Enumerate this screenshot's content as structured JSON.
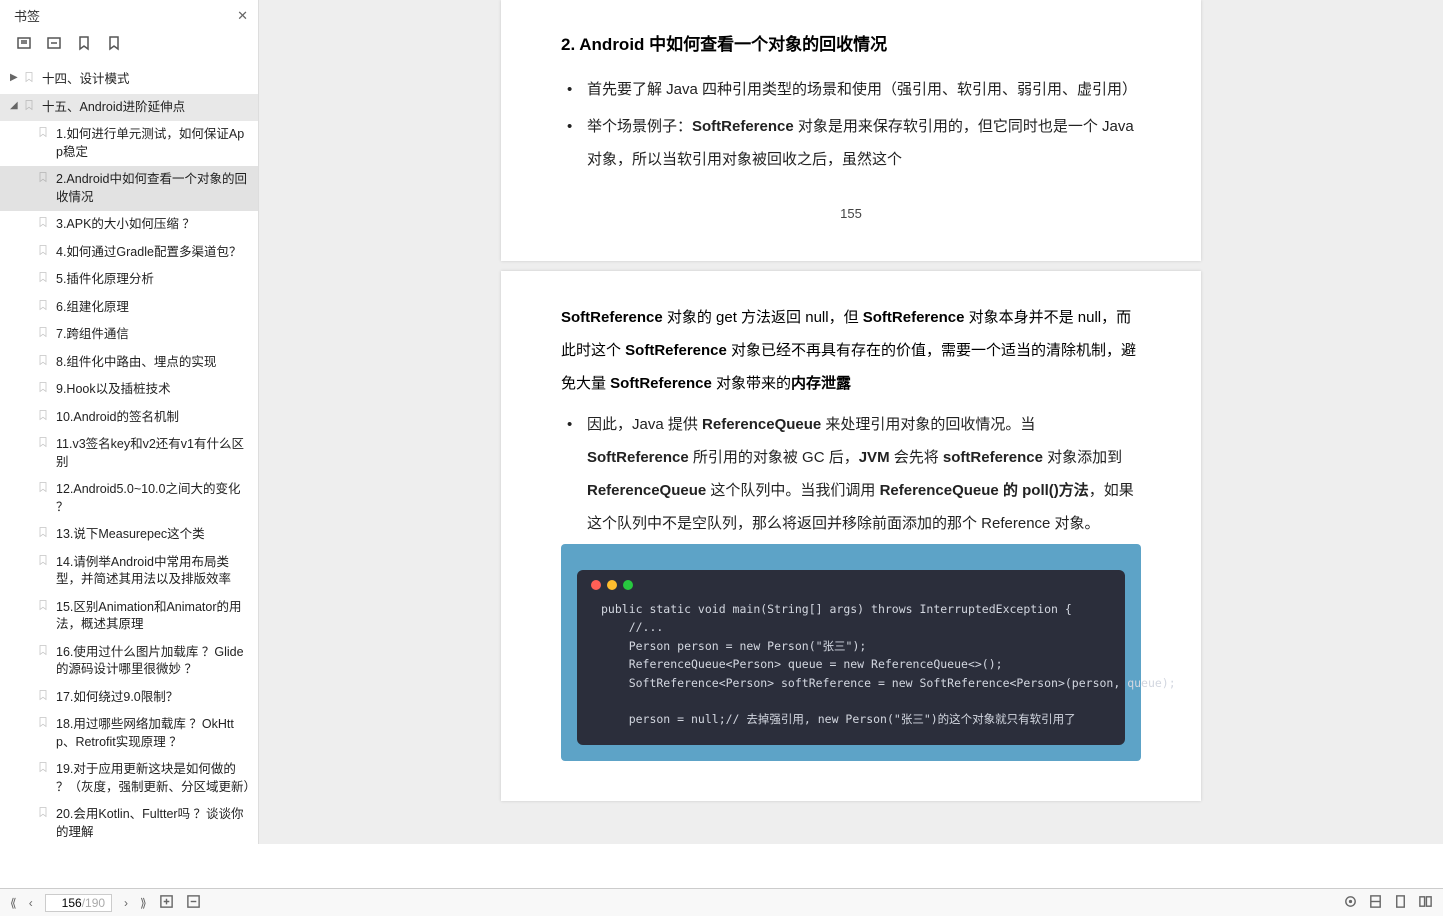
{
  "sidebar": {
    "title": "书签",
    "items": [
      {
        "label": "十四、设计模式",
        "level": 0,
        "caret": "▶"
      },
      {
        "label": "十五、Android进阶延伸点",
        "level": 0,
        "caret": "◢",
        "selected": false,
        "expanded": true
      },
      {
        "label": "1.如何进行单元测试，如何保证App稳定",
        "level": 1
      },
      {
        "label": "2.Android中如何查看一个对象的回收情况",
        "level": 1,
        "selected": true
      },
      {
        "label": "3.APK的大小如何压缩 ？",
        "level": 1
      },
      {
        "label": "4.如何通过Gradle配置多渠道包？",
        "level": 1
      },
      {
        "label": "5.插件化原理分析",
        "level": 1
      },
      {
        "label": "6.组建化原理",
        "level": 1
      },
      {
        "label": "7.跨组件通信",
        "level": 1
      },
      {
        "label": "8.组件化中路由、埋点的实现",
        "level": 1
      },
      {
        "label": "9.Hook以及插桩技术",
        "level": 1
      },
      {
        "label": "10.Android的签名机制",
        "level": 1
      },
      {
        "label": "11.v3签名key和v2还有v1有什么区别",
        "level": 1
      },
      {
        "label": "12.Android5.0~10.0之间大的变化 ？",
        "level": 1
      },
      {
        "label": "13.说下Measurepec这个类",
        "level": 1
      },
      {
        "label": "14.请例举Android中常用布局类型，并简述其用法以及排版效率",
        "level": 1
      },
      {
        "label": "15.区别Animation和Animator的用法，概述其原理",
        "level": 1
      },
      {
        "label": "16.使用过什么图片加载库 ？Glide的源码设计哪里很微妙 ？",
        "level": 1
      },
      {
        "label": "17.如何绕过9.0限制？",
        "level": 1
      },
      {
        "label": "18.用过哪些网络加载库 ？OkHttp、Retrofit实现原理 ？",
        "level": 1
      },
      {
        "label": "19.对于应用更新这块是如何做的 ？（灰度，强制更新、分区域更新）",
        "level": 1
      },
      {
        "label": "20.会用Kotlin、Fultter吗 ？谈谈你的理解",
        "level": 1
      }
    ]
  },
  "doc": {
    "page1": {
      "heading": "2.  Android 中如何查看一个对象的回收情况",
      "bullet1": "首先要了解 Java 四种引用类型的场景和使用（强引用、软引用、弱引用、虚引用）",
      "bullet2_pre": "举个场景例子：",
      "bullet2_b1": "SoftReference",
      "bullet2_mid": " 对象是用来保存软引用的，但它同时也是一个 Java 对象，所以当软引用对象被回收之后，虽然这个",
      "pagenum": "155"
    },
    "page2": {
      "para1_a": "SoftReference",
      "para1_b": " 对象的 get 方法返回 null，但 ",
      "para1_c": "SoftReference",
      "para1_d": " 对象本身并不是 null，而此时这个 ",
      "para1_e": "SoftReference",
      "para1_f": " 对象已经不再具有存在的价值，需要一个适当的清除机制，避免大量 ",
      "para1_g": "SoftReference",
      "para1_h": " 对象带来的",
      "para1_i": "内存泄露",
      "b2a": "因此，Java 提供 ",
      "b2b": "ReferenceQueue",
      "b2c": " 来处理引用对象的回收情况。当 ",
      "b2d": "SoftReference",
      "b2e": " 所引用的对象被 GC 后，",
      "b2f": "JVM",
      "b2g": " 会先将 ",
      "b2h": "softReference",
      "b2i": " 对象添加到 ",
      "b2j": "ReferenceQueue",
      "b2k": " 这个队列中。当我们调用 ",
      "b2l": "ReferenceQueue 的 poll()方法",
      "b2m": "，如果这个队列中不是空队列，那么将返回并移除前面添加的那个 Reference 对象。",
      "code": "public static void main(String[] args) throws InterruptedException {\n    //...\n    Person person = new Person(\"张三\");\n    ReferenceQueue<Person> queue = new ReferenceQueue<>();\n    SoftReference<Person> softReference = new SoftReference<Person>(person, queue);\n\n    person = null;// 去掉强引用, new Person(\"张三\")的这个对象就只有软引用了"
    }
  },
  "footer": {
    "current": "156",
    "total": "/190"
  }
}
